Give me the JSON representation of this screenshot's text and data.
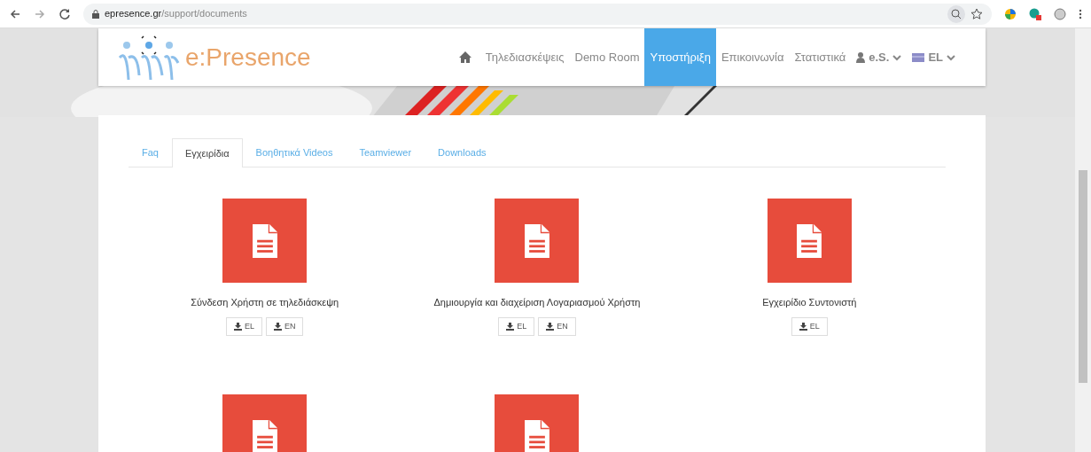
{
  "browser": {
    "url_host": "epresence.gr",
    "url_path": "/support/documents"
  },
  "navbar": {
    "logo": "e:Presence",
    "items": [
      {
        "kind": "home",
        "selected": false
      },
      {
        "kind": "link",
        "label": "Τηλεδιασκέψεις",
        "selected": false
      },
      {
        "kind": "link",
        "label": "Demo Room",
        "selected": false
      },
      {
        "kind": "link",
        "label": "Υποστήριξη",
        "selected": true
      },
      {
        "kind": "link",
        "label": "Επικοινωνία",
        "selected": false
      },
      {
        "kind": "link",
        "label": "Στατιστικά",
        "selected": false
      },
      {
        "kind": "user",
        "label": "e.S.",
        "selected": false
      },
      {
        "kind": "language",
        "label": "EL",
        "selected": false
      }
    ]
  },
  "tabs": [
    {
      "label": "Faq",
      "selected": false
    },
    {
      "label": "Εγχειρίδια",
      "selected": true
    },
    {
      "label": "Βοηθητικά Videos",
      "selected": false
    },
    {
      "label": "Teamviewer",
      "selected": false
    },
    {
      "label": "Downloads",
      "selected": false
    }
  ],
  "documents": [
    {
      "kind": "document",
      "title": "Σύνδεση Χρήστη σε τηλεδιάσκεψη",
      "downloads": [
        "EL",
        "EN"
      ]
    },
    {
      "kind": "document",
      "title": "Δημιουργία και διαχείριση Λογαριασμού Χρήστη",
      "downloads": [
        "EL",
        "EN"
      ]
    },
    {
      "kind": "document",
      "title": "Εγχειρίδιο Συντονιστή",
      "downloads": [
        "EL"
      ]
    },
    {
      "kind": "document"
    },
    {
      "kind": "document"
    }
  ]
}
